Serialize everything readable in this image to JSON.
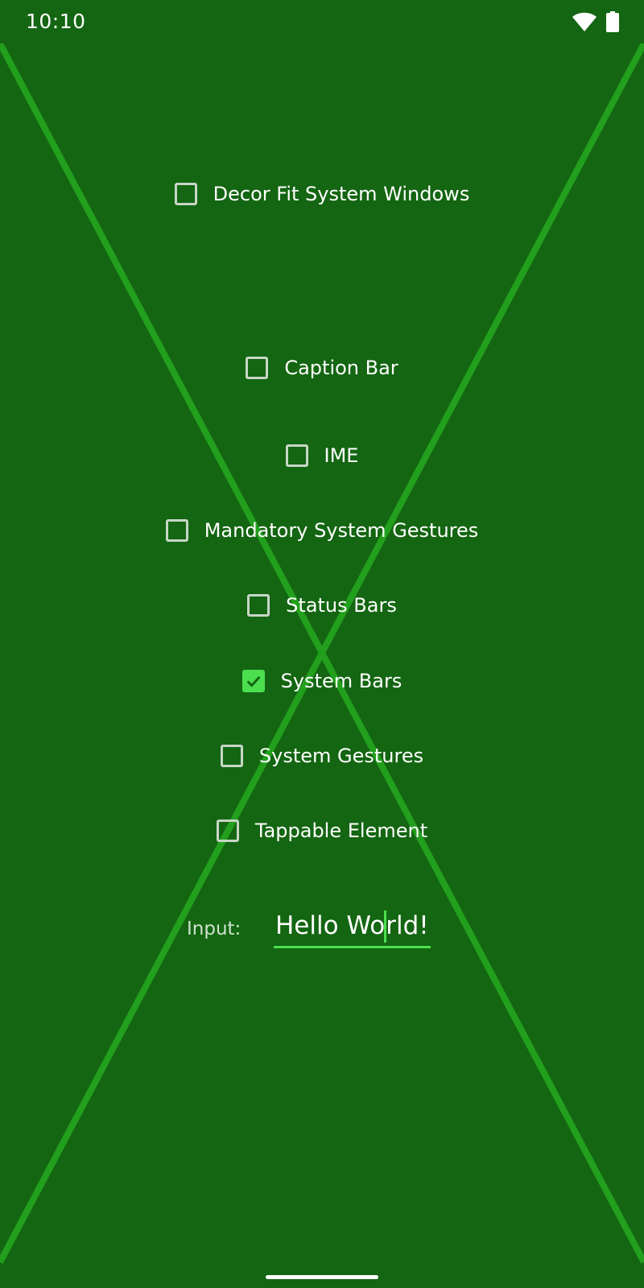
{
  "status_bar": {
    "time": "10:10",
    "icons": [
      "wifi-icon",
      "battery-icon"
    ]
  },
  "options": [
    {
      "label": "Decor Fit System Windows",
      "checked": false
    },
    {
      "label": "Caption Bar",
      "checked": false
    },
    {
      "label": "IME",
      "checked": false
    },
    {
      "label": "Mandatory System Gestures",
      "checked": false
    },
    {
      "label": "Status Bars",
      "checked": false
    },
    {
      "label": "System Bars",
      "checked": true
    },
    {
      "label": "System Gestures",
      "checked": false
    },
    {
      "label": "Tappable Element",
      "checked": false
    }
  ],
  "input": {
    "label": "Input:",
    "value_before_caret": "Hello Wo",
    "value_after_caret": "rld!"
  },
  "colors": {
    "background": "#146612",
    "diagonal_lines": "#22a01d",
    "accent": "#4bde4f",
    "checkbox_border": "#c7d6c6"
  }
}
